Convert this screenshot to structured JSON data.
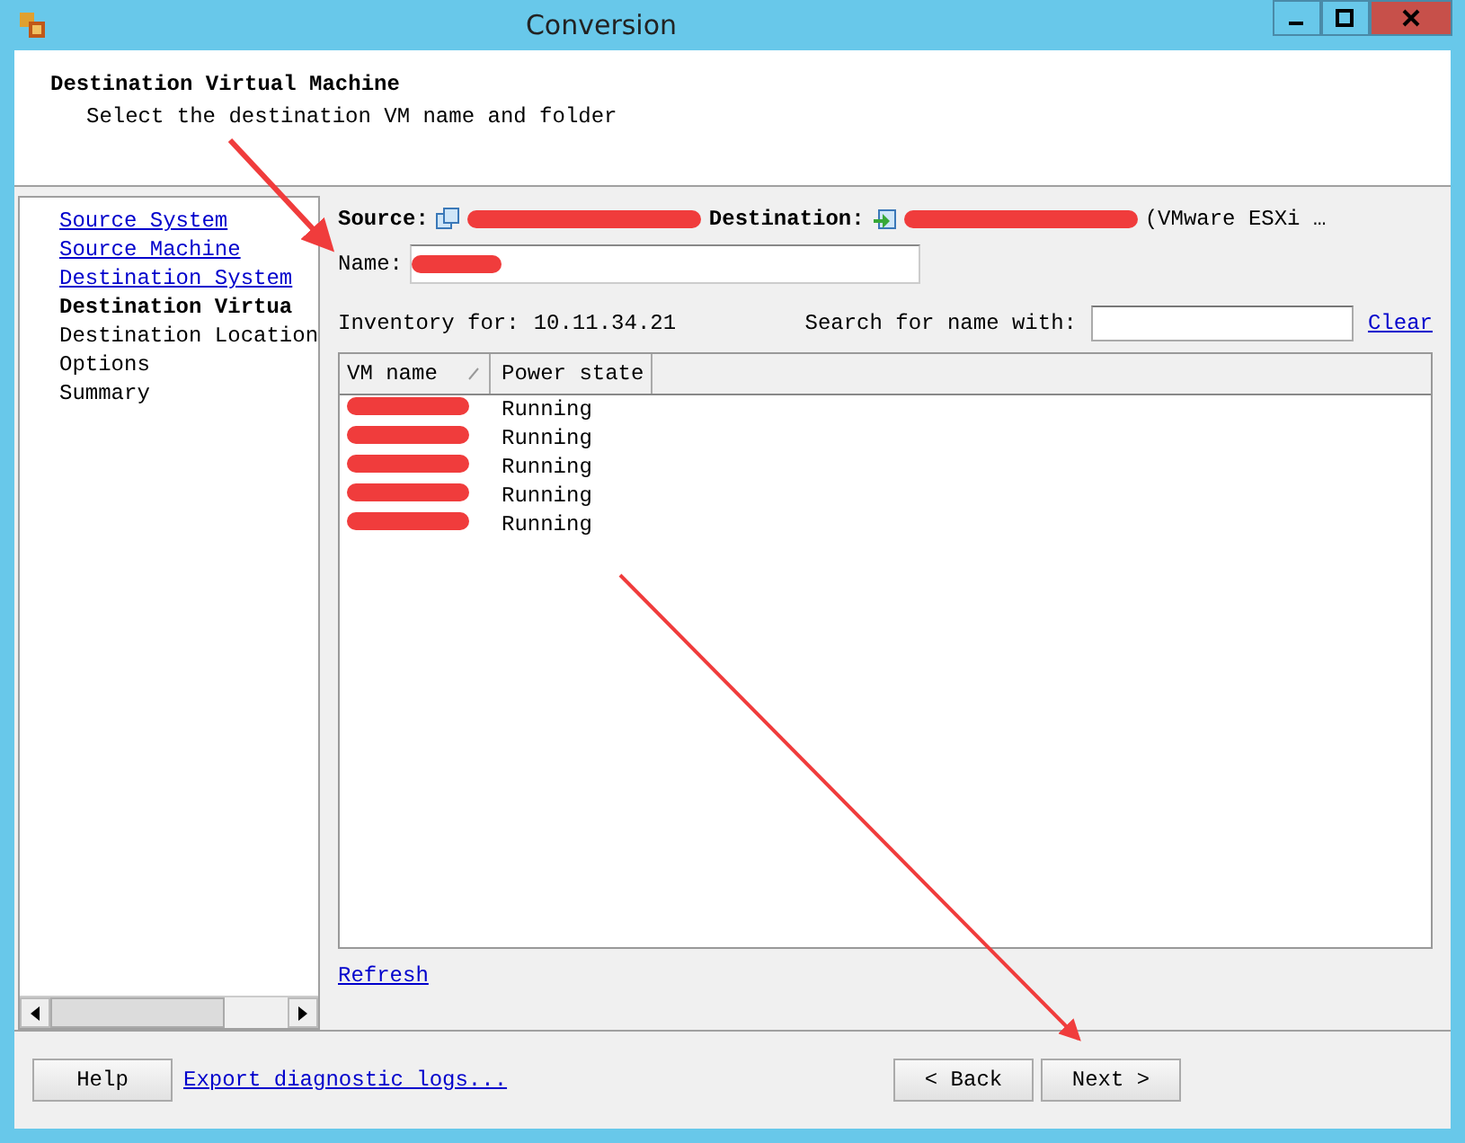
{
  "window": {
    "title": "Conversion"
  },
  "header": {
    "title": "Destination Virtual Machine",
    "subtitle": "Select the destination VM name and folder"
  },
  "steps": [
    {
      "label": "Source System",
      "kind": "link",
      "selected": false
    },
    {
      "label": "Source Machine",
      "kind": "link",
      "selected": false
    },
    {
      "label": "Destination System",
      "kind": "link",
      "selected": false
    },
    {
      "label": "Destination Virtua",
      "kind": "step",
      "selected": true
    },
    {
      "label": "Destination Location",
      "kind": "step",
      "selected": false
    },
    {
      "label": "Options",
      "kind": "step",
      "selected": false
    },
    {
      "label": "Summary",
      "kind": "step",
      "selected": false
    }
  ],
  "summary": {
    "source_label": "Source:",
    "destination_label": "Destination:",
    "destination_suffix": "(VMware ESXi …"
  },
  "name_field": {
    "label": "Name:"
  },
  "inventory": {
    "label": "Inventory for:",
    "host": "10.11.34.21"
  },
  "search": {
    "label": "Search for name with:",
    "clear": "Clear"
  },
  "table": {
    "columns": [
      "VM name",
      "Power state"
    ],
    "rows": [
      {
        "power_state": "Running"
      },
      {
        "power_state": "Running"
      },
      {
        "power_state": "Running"
      },
      {
        "power_state": "Running"
      },
      {
        "power_state": "Running"
      }
    ]
  },
  "refresh": "Refresh",
  "footer": {
    "help": "Help",
    "export": "Export diagnostic logs...",
    "back": "< Back",
    "next": "Next >"
  }
}
